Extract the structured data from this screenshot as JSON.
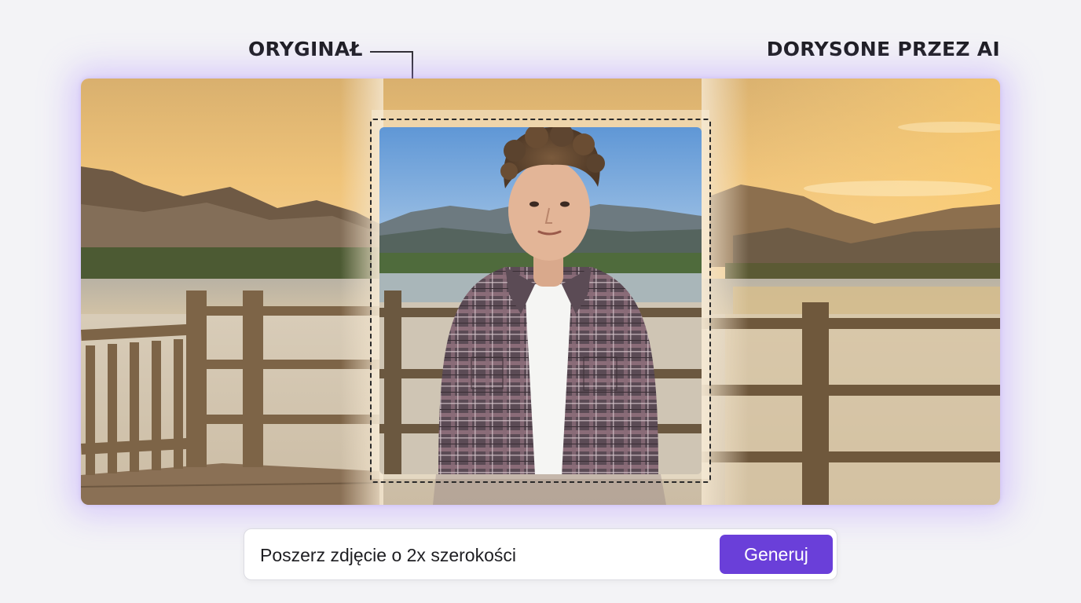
{
  "labels": {
    "original": "ORYGINAŁ",
    "ai_extended": "DORYSONE PRZEZ AI"
  },
  "prompt": {
    "value": "Poszerz zdjęcie o 2x szerokości",
    "button_label": "Generuj"
  },
  "colors": {
    "page_background": "#f3f3f6",
    "accent": "#6a3fd9",
    "glow": "#b496ff",
    "label_text": "#1c1c20"
  },
  "icons": {
    "pointer": "arrow-down-icon"
  }
}
